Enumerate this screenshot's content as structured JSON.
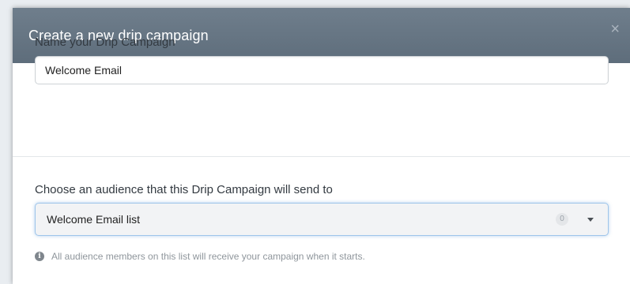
{
  "modal": {
    "title": "Create a new drip campaign",
    "close_glyph": "×"
  },
  "name_section": {
    "label": "Name your Drip Campaign",
    "input_value": "Welcome Email"
  },
  "audience_section": {
    "label": "Choose an audience that this Drip Campaign will send to",
    "selected_value": "Welcome Email list",
    "member_count": "0",
    "help_text": "All audience members on this list will receive your campaign when it starts.",
    "help_icon": "info-icon"
  },
  "colors": {
    "header_bg": "#6f7e8c",
    "select_focus_border": "#9fc5ea",
    "label_text": "#333a41",
    "help_text": "#8f969c"
  }
}
